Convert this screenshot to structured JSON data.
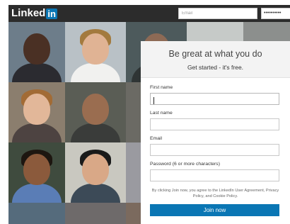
{
  "header": {
    "logo_text": "Linked",
    "logo_badge": "in",
    "email_placeholder": "Email",
    "password_mask": "••••••••••"
  },
  "signup": {
    "title": "Be great at what you do",
    "subtitle": "Get started - it's free.",
    "first_name_label": "First name",
    "last_name_label": "Last name",
    "email_label": "Email",
    "password_label": "Password (6 or more characters)",
    "terms_text": "By clicking Join now, you agree to the LinkedIn User Agreement, Privacy Policy, and Cookie Policy.",
    "join_label": "Join now"
  },
  "colors": {
    "brand_blue": "#0a76b4",
    "topbar": "#2c2c2c"
  }
}
